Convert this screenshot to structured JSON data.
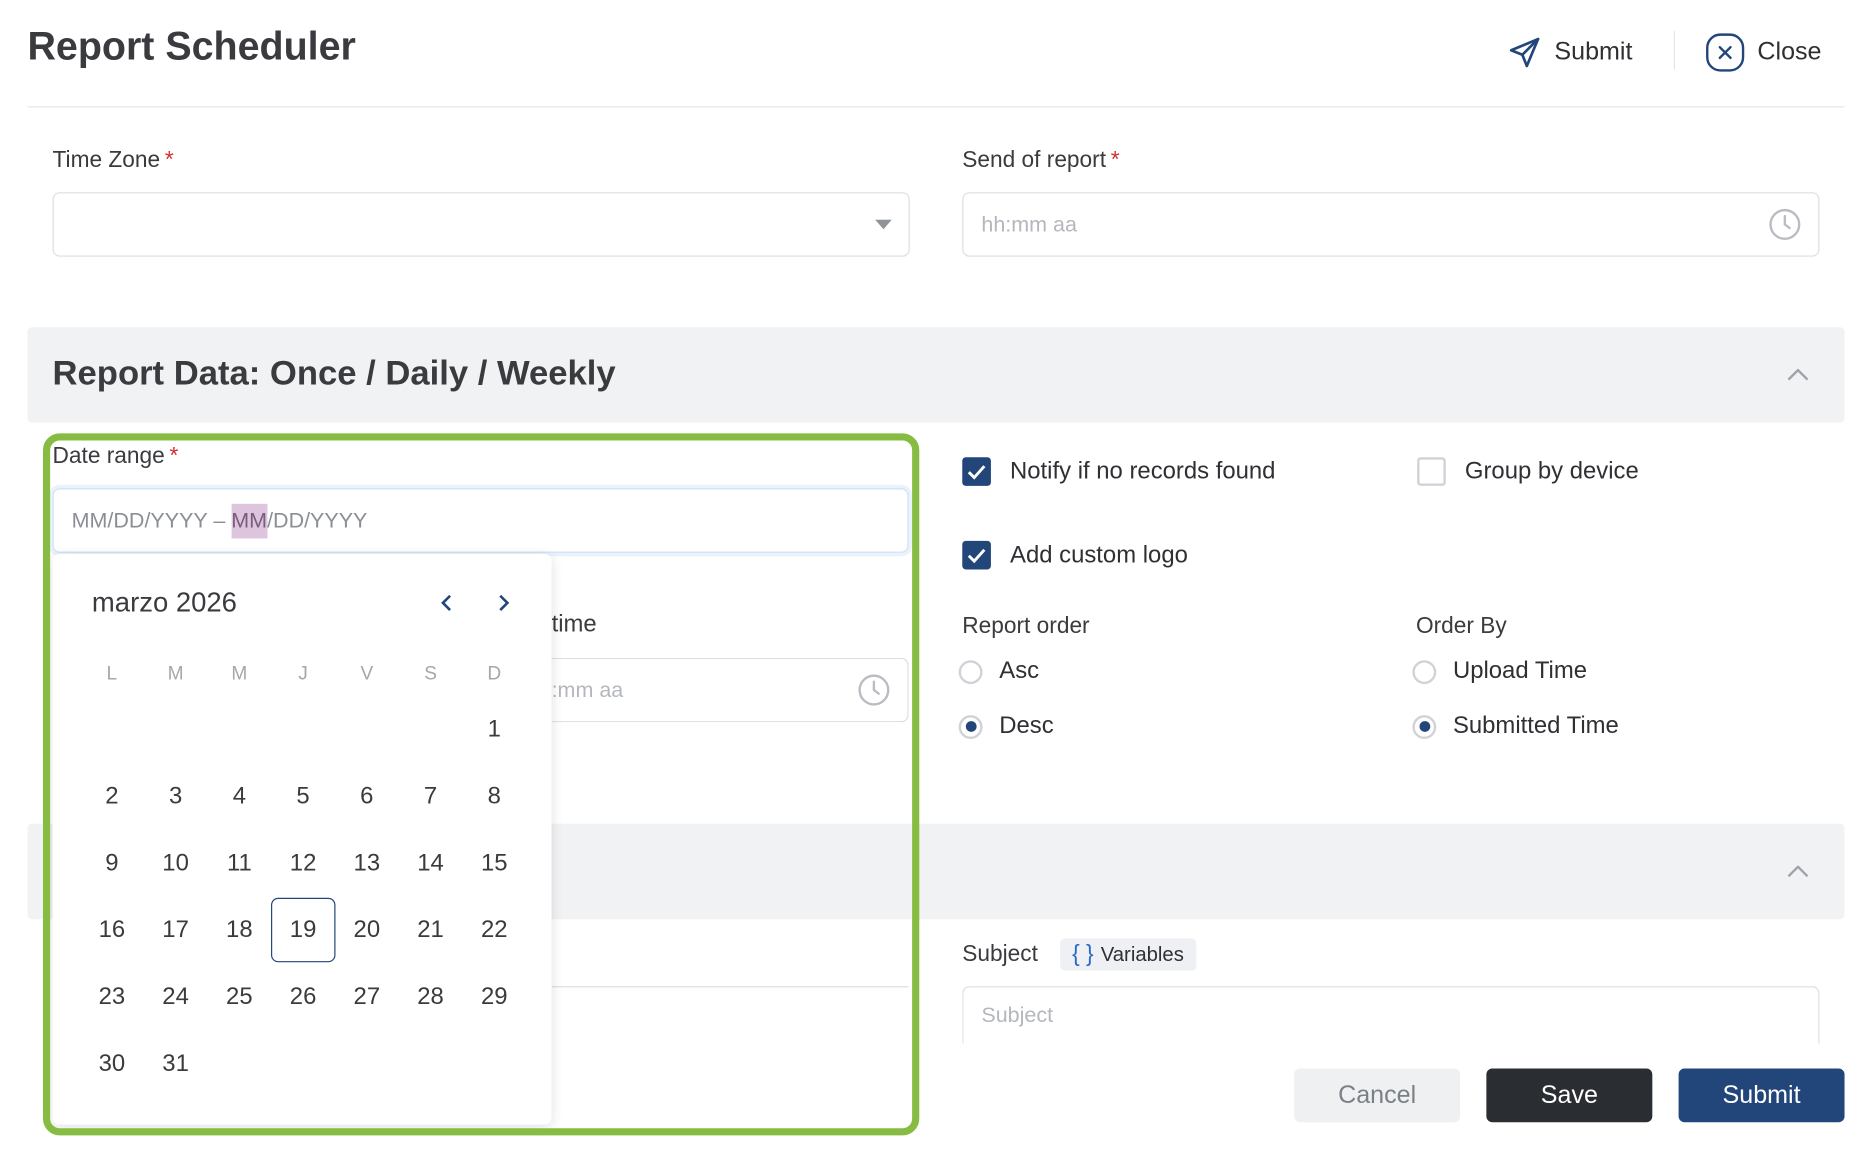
{
  "header": {
    "title": "Report Scheduler",
    "submit_label": "Submit",
    "close_label": "Close"
  },
  "schedule": {
    "time_zone_label": "Time Zone",
    "time_zone_value": "",
    "send_label": "Send of report",
    "send_placeholder": "hh:mm aa",
    "required_mark": "*"
  },
  "report_data": {
    "section_title": "Report Data: Once / Daily / Weekly",
    "date_range_label": "Date range",
    "date_range_placeholder_a": "MM/DD/YYYY – ",
    "date_range_placeholder_seg": "MM",
    "date_range_placeholder_b": "/DD/YYYY",
    "time_label_partial": "time",
    "time_placeholder_partial": ":mm aa",
    "options": {
      "notify_label": "Notify if no records found",
      "notify_checked": true,
      "group_label": "Group by device",
      "group_checked": false,
      "logo_label": "Add custom logo",
      "logo_checked": true
    },
    "report_order": {
      "label": "Report order",
      "options": [
        "Asc",
        "Desc"
      ],
      "selected": "Desc"
    },
    "order_by": {
      "label": "Order By",
      "options": [
        "Upload Time",
        "Submitted Time"
      ],
      "selected": "Submitted Time"
    }
  },
  "email": {
    "subject_label": "Subject",
    "variables_label": "Variables",
    "subject_placeholder": "Subject"
  },
  "calendar": {
    "month_label": "marzo 2026",
    "weekdays": [
      "L",
      "M",
      "M",
      "J",
      "V",
      "S",
      "D"
    ],
    "weeks": [
      [
        "",
        "",
        "",
        "",
        "",
        "",
        "1"
      ],
      [
        "2",
        "3",
        "4",
        "5",
        "6",
        "7",
        "8"
      ],
      [
        "9",
        "10",
        "11",
        "12",
        "13",
        "14",
        "15"
      ],
      [
        "16",
        "17",
        "18",
        "19",
        "20",
        "21",
        "22"
      ],
      [
        "23",
        "24",
        "25",
        "26",
        "27",
        "28",
        "29"
      ],
      [
        "30",
        "31",
        "",
        "",
        "",
        "",
        ""
      ]
    ],
    "today": "19"
  },
  "footer": {
    "cancel_label": "Cancel",
    "save_label": "Save",
    "submit_label": "Submit"
  },
  "colors": {
    "primary": "#22467a",
    "highlight": "#86bc42",
    "required": "#d32f2f",
    "dark_button": "#2a2d31"
  },
  "icons": {
    "submit": "paper-plane-icon",
    "close": "close-circle-icon",
    "time": "clock-icon",
    "dropdown": "caret-down-icon",
    "collapse": "chevron-up-icon",
    "prev": "chevron-left-icon",
    "next": "chevron-right-icon"
  }
}
